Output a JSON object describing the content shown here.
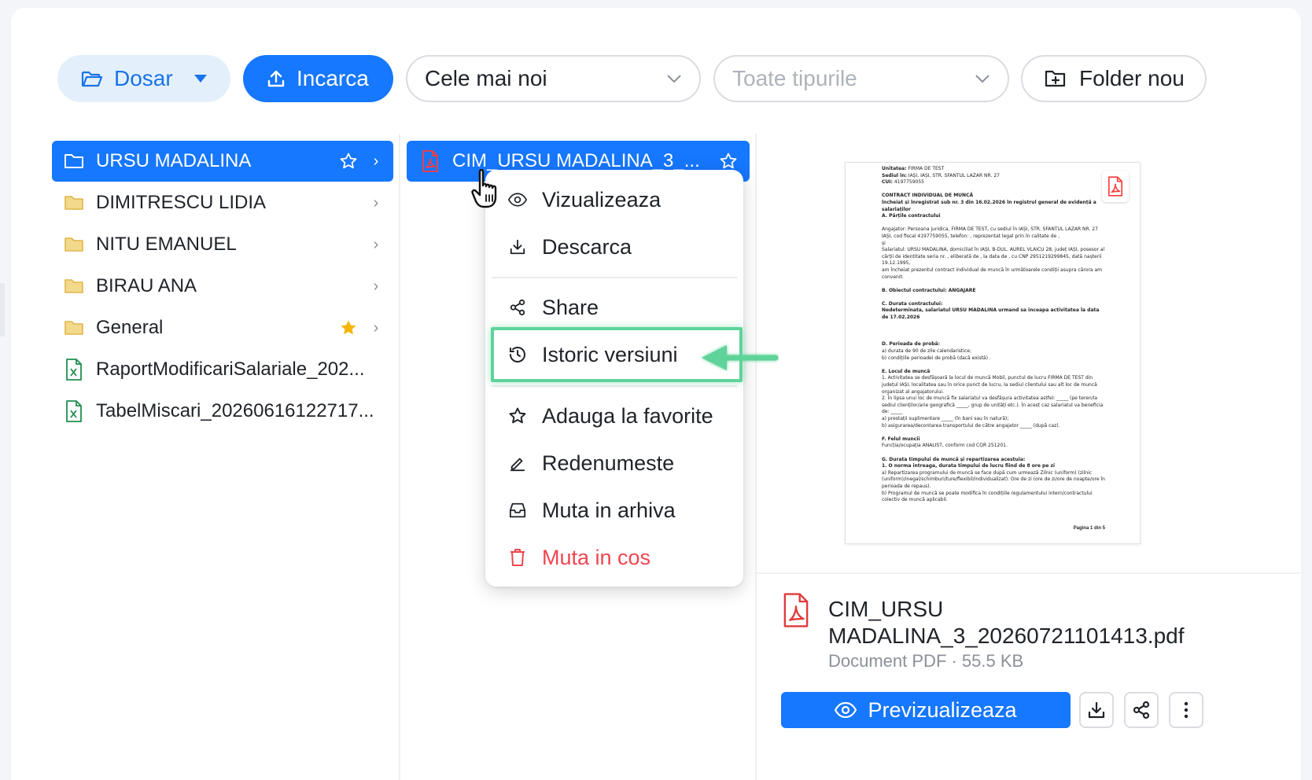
{
  "toolbar": {
    "dosar_label": "Dosar",
    "upload_label": "Incarca",
    "sort_value": "Cele mai noi",
    "type_placeholder": "Toate tipurile",
    "new_folder_label": "Folder nou"
  },
  "folders": [
    {
      "name": "URSU MADALINA",
      "selected": true,
      "starred": false
    },
    {
      "name": "DIMITRESCU LIDIA"
    },
    {
      "name": "NITU EMANUEL"
    },
    {
      "name": "BIRAU ANA"
    },
    {
      "name": "General",
      "starred": true
    }
  ],
  "files_col1": [
    {
      "name": "RaportModificariSalariale_202..."
    },
    {
      "name": "TabelMiscari_20260616122717..."
    }
  ],
  "col2": {
    "selected_file": "CIM_URSU MADALINA_3_..."
  },
  "context_menu": {
    "view": "Vizualizeaza",
    "download": "Descarca",
    "share": "Share",
    "history": "Istoric versiuni",
    "favorite": "Adauga la favorite",
    "rename": "Redenumeste",
    "archive": "Muta in arhiva",
    "trash": "Muta in cos"
  },
  "document_preview": {
    "lines": [
      {
        "b": "Unitatea:",
        "t": "      FIRMA DE TEST"
      },
      {
        "b": "Sediul în:",
        "t": "     IAȘI, IAȘI, STR. SFANTUL LAZAR NR. 27"
      },
      {
        "b": "CUI:",
        "t": "           4197759055"
      },
      {
        "b": "",
        "t": ""
      },
      {
        "b": "                         CONTRACT INDIVIDUAL DE MUNCĂ",
        "t": ""
      },
      {
        "b": "      încheiat și înregistrat sub nr. 3 din 16.02.2026 în registrul general de evidență a",
        "t": ""
      },
      {
        "b": "                                           salariaților",
        "t": ""
      },
      {
        "b": "A. Părțile contractului",
        "t": ""
      },
      {
        "b": "",
        "t": ""
      },
      {
        "b": "",
        "t": "Angajator: Persoana juridica, FIRMA DE TEST, cu sediul în IAȘI, STR. SFANTUL LAZAR NR. 27 IAȘI, cod fiscal 4197759055, telefon: , reprezentat legal prin în calitate de ,"
      },
      {
        "b": "",
        "t": "și"
      },
      {
        "b": "",
        "t": "Salariatul: URSU MADALINA, domiciliat în IAȘI, B-DUL. AUREL VLAICU 28, județ IAȘI, posesor al cărții de identitate seria nr. , eliberată de , la data de , cu CNP 2951219299845, dată nașterii 19.12.1995,"
      },
      {
        "b": "",
        "t": "am încheiat prezentul contract individual de muncă în următoarele condiții asupra cărora am convenit:"
      },
      {
        "b": "",
        "t": ""
      },
      {
        "b": "B. Obiectul contractului: ANGAJARE",
        "t": ""
      },
      {
        "b": "",
        "t": ""
      },
      {
        "b": "C. Durata contractului:",
        "t": ""
      },
      {
        "b": "Nedeterminata, salariatul URSU MADALINA urmand sa inceapa activitatea la data de 17.02.2026",
        "t": ""
      },
      {
        "b": "",
        "t": ""
      },
      {
        "b": "",
        "t": ""
      },
      {
        "b": "",
        "t": ""
      },
      {
        "b": "D. Perioada de probă:",
        "t": ""
      },
      {
        "b": "",
        "t": "a) durata de 90 de zile calendaristice;"
      },
      {
        "b": "",
        "t": "b) condițiile perioadei de probă (dacă există) ."
      },
      {
        "b": "",
        "t": ""
      },
      {
        "b": "E. Locul de muncă",
        "t": ""
      },
      {
        "b": "",
        "t": "1. Activitatea se desfășoară la locul de muncă Mobil, punctul de lucru FIRMA DE TEST din județul IAȘI, localitatea sau în orice punct de lucru, la sediul clientului sau alt loc de muncă organizat al angajatorului."
      },
      {
        "b": "",
        "t": "2. În lipsa unui loc de muncă fix salariatul va desfășura activitatea astfel: _____ (pe teren/la sediul clienților/arie geografică _____, grup de unități etc.). În acest caz salariatul va beneficia de: _____"
      },
      {
        "b": "",
        "t": "a) prestații suplimentare _____ (în bani sau în natură);"
      },
      {
        "b": "",
        "t": "b) asigurarea/decontarea transportului de către angajator _____ (după caz)."
      },
      {
        "b": "",
        "t": ""
      },
      {
        "b": "F. Felul muncii",
        "t": ""
      },
      {
        "b": "",
        "t": "Funcția/ocupația ANALIST, conform cod COR 251201."
      },
      {
        "b": "",
        "t": ""
      },
      {
        "b": "G. Durata timpului de muncă și repartizarea acestuia:",
        "t": ""
      },
      {
        "b": "1. O norma intreaga, durata timpului de lucru fiind de 8 ore pe zi",
        "t": ""
      },
      {
        "b": "",
        "t": "a) Repartizarea programului de muncă se face după cum urmează Zilnic (uniform) (zilnic (uniform)/inegal/schimburi/ture/flexibil/individualizat). Ore de zi (ore de zi/ore de noapte/ore în perioada de repaus)."
      },
      {
        "b": "",
        "t": "b) Programul de muncă se poate modifica în condițiile regulamentului intern/contractului colectiv de muncă aplicabil."
      }
    ],
    "page_label": "Pagina 1 din 5"
  },
  "details": {
    "file_name": "CIM_URSU MADALINA_3_20260721101413.pdf",
    "meta": "Document PDF · 55.5 KB",
    "preview_button": "Previzualizeaza"
  }
}
